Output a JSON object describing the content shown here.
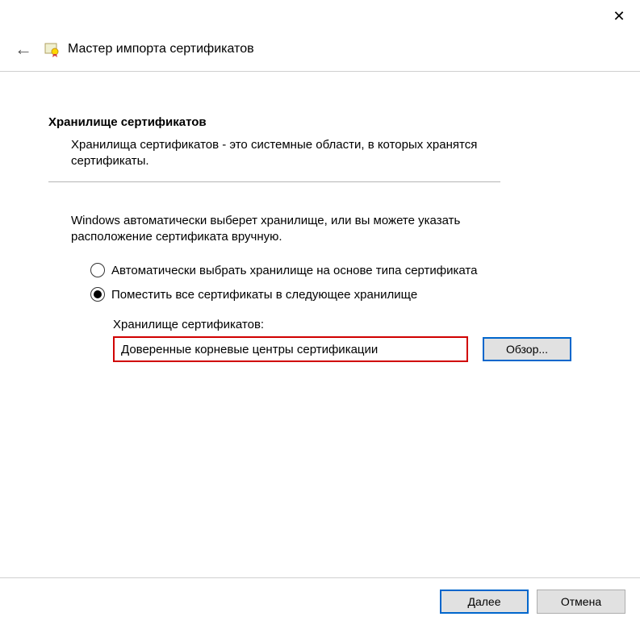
{
  "header": {
    "title": "Мастер импорта сертификатов"
  },
  "section": {
    "title": "Хранилище сертификатов",
    "description": "Хранилища сертификатов - это системные области, в которых хранятся сертификаты."
  },
  "instruction": "Windows автоматически выберет хранилище, или вы можете указать расположение сертификата вручную.",
  "radios": {
    "auto": "Автоматически выбрать хранилище на основе типа сертификата",
    "manual": "Поместить все сертификаты в следующее хранилище",
    "selected": "manual"
  },
  "store": {
    "label": "Хранилище сертификатов:",
    "value": "Доверенные корневые центры сертификации",
    "browse": "Обзор..."
  },
  "footer": {
    "next": "Далее",
    "cancel": "Отмена"
  }
}
